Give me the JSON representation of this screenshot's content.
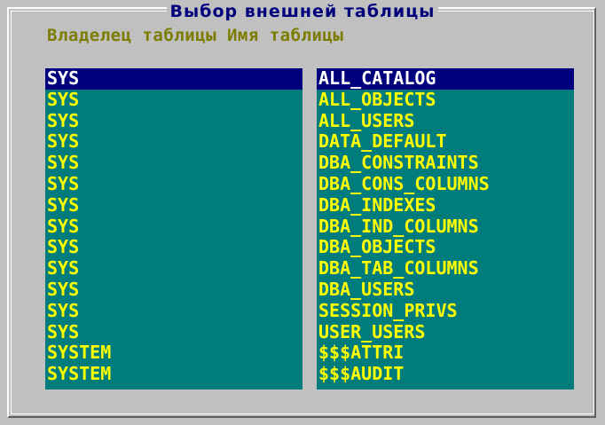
{
  "dialog": {
    "title": "Выбор внешней таблицы",
    "header": "Владелец таблицы Имя таблицы"
  },
  "owners": [
    "SYS",
    "SYS",
    "SYS",
    "SYS",
    "SYS",
    "SYS",
    "SYS",
    "SYS",
    "SYS",
    "SYS",
    "SYS",
    "SYS",
    "SYS",
    "SYSTEM",
    "SYSTEM"
  ],
  "tables": [
    "ALL_CATALOG",
    "ALL_OBJECTS",
    "ALL_USERS",
    "DATA_DEFAULT",
    "DBA_CONSTRAINTS",
    "DBA_CONS_COLUMNS",
    "DBA_INDEXES",
    "DBA_IND_COLUMNS",
    "DBA_OBJECTS",
    "DBA_TAB_COLUMNS",
    "DBA_USERS",
    "SESSION_PRIVS",
    "USER_USERS",
    "$$$ATTRI",
    "$$$AUDIT"
  ],
  "selected_index": 0,
  "colors": {
    "list_bg": "#007c7c",
    "item_text": "#ffff00",
    "selection_bg": "#00007c",
    "selection_text": "#ffffff",
    "title_text": "#00007c",
    "header_text": "#7c7c00",
    "dialog_bg": "#c0c0c0"
  }
}
